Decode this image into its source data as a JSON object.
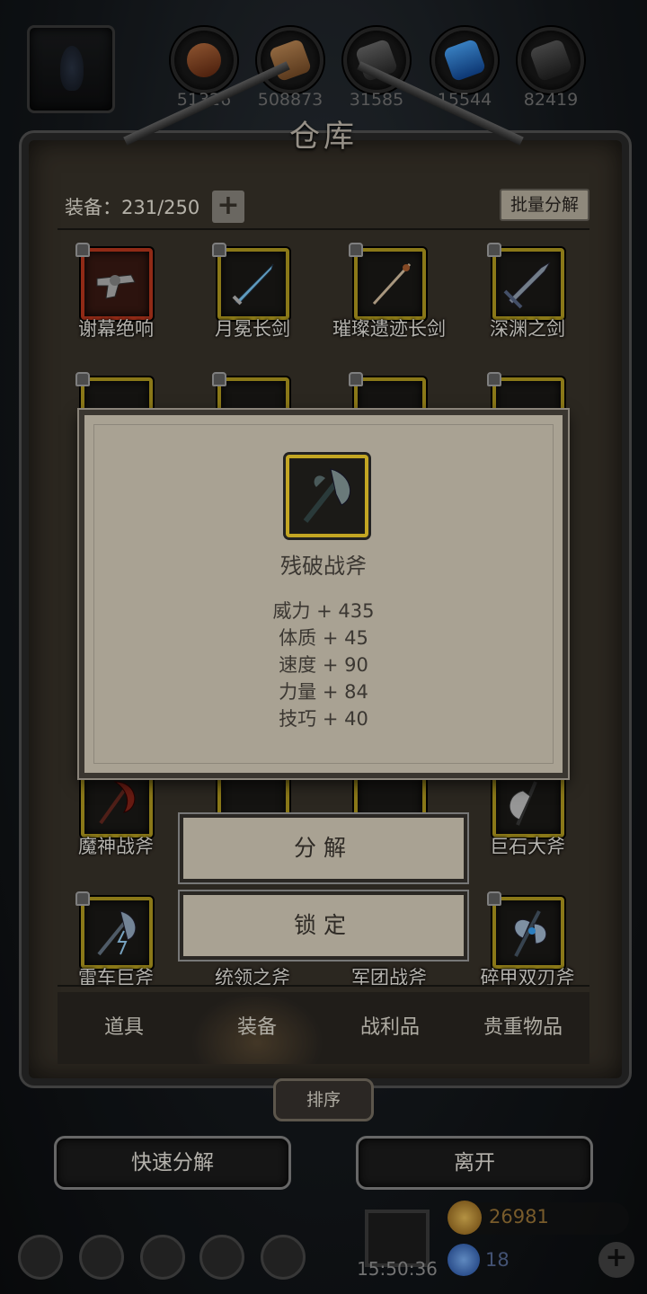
{
  "resources": [
    {
      "icon": "wood-orb-icon",
      "count": "51326"
    },
    {
      "icon": "plank-icon",
      "count": "508873"
    },
    {
      "icon": "iron-icon",
      "count": "31585"
    },
    {
      "icon": "crystal-icon",
      "count": "15544"
    },
    {
      "icon": "ore-icon",
      "count": "82419"
    }
  ],
  "panel": {
    "title": "仓库",
    "equip_count": "装备：231/250",
    "add_symbol": "+",
    "batch_label": "批量分解"
  },
  "items": [
    {
      "name": "谢幕绝响",
      "icon": "revolver-icon",
      "rarity": "red"
    },
    {
      "name": "月冕长剑",
      "icon": "longsword-icon",
      "rarity": "gold"
    },
    {
      "name": "璀璨遗迹长剑",
      "icon": "rapier-icon",
      "rarity": "gold"
    },
    {
      "name": "深渊之剑",
      "icon": "greatsword-icon",
      "rarity": "gold"
    },
    {
      "name": "魔神战斧",
      "icon": "demon-axe-icon",
      "rarity": "gold"
    },
    {
      "name": "",
      "icon": "axe-icon",
      "rarity": "gold"
    },
    {
      "name": "",
      "icon": "double-axe-icon",
      "rarity": "gold"
    },
    {
      "name": "巨石大斧",
      "icon": "stone-axe-icon",
      "rarity": "gold"
    },
    {
      "name": "雷车巨斧",
      "icon": "thunder-axe-icon",
      "rarity": "gold"
    },
    {
      "name": "统领之斧",
      "icon": "axe-icon",
      "rarity": "gold"
    },
    {
      "name": "军团战斧",
      "icon": "axe-icon",
      "rarity": "gold"
    },
    {
      "name": "碎甲双刃斧",
      "icon": "double-axe-icon",
      "rarity": "gold"
    }
  ],
  "tabs": [
    {
      "label": "道具"
    },
    {
      "label": "装备"
    },
    {
      "label": "战利品"
    },
    {
      "label": "贵重物品"
    }
  ],
  "sort_label": "排序",
  "bottom": {
    "quick_decompose": "快速分解",
    "leave": "离开"
  },
  "footer": {
    "timer": "15:50:36",
    "gold": "26981",
    "gems": "18",
    "add_symbol": "+"
  },
  "popup": {
    "item_name": "残破战斧",
    "item_icon": "battle-axe-icon",
    "stats": [
      "威力 + 435",
      "体质 + 45",
      "速度 + 90",
      "力量 + 84",
      "技巧 + 40"
    ],
    "decompose_label": "分解",
    "lock_label": "锁定"
  },
  "colors": {
    "gold_frame": "#b8a020",
    "red_frame": "#c0381e",
    "popup_bg": "#a9a293"
  }
}
